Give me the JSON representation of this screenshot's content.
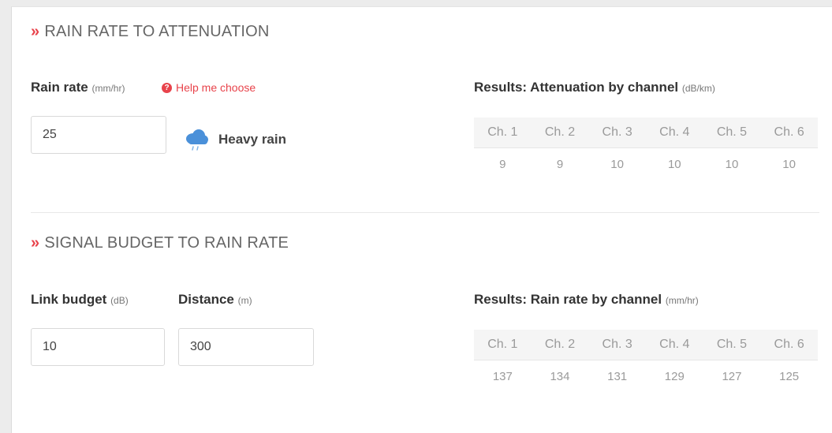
{
  "rain_to_attenuation": {
    "section_title": "RAIN RATE TO ATTENUATION",
    "rain_rate": {
      "label": "Rain rate",
      "unit": "(mm/hr)",
      "value": "25"
    },
    "help_link": "Help me choose",
    "weather_label": "Heavy rain",
    "results": {
      "title": "Results: Attenuation by channel",
      "unit": "(dB/km)",
      "columns": [
        "Ch. 1",
        "Ch. 2",
        "Ch. 3",
        "Ch. 4",
        "Ch. 5",
        "Ch. 6"
      ],
      "values": [
        "9",
        "9",
        "10",
        "10",
        "10",
        "10"
      ]
    }
  },
  "budget_to_rain_rate": {
    "section_title": "SIGNAL BUDGET TO RAIN RATE",
    "link_budget": {
      "label": "Link budget",
      "unit": "(dB)",
      "value": "10"
    },
    "distance": {
      "label": "Distance",
      "unit": "(m)",
      "value": "300"
    },
    "results": {
      "title": "Results: Rain rate by channel",
      "unit": "(mm/hr)",
      "columns": [
        "Ch. 1",
        "Ch. 2",
        "Ch. 3",
        "Ch. 4",
        "Ch. 5",
        "Ch. 6"
      ],
      "values": [
        "137",
        "134",
        "131",
        "129",
        "127",
        "125"
      ]
    }
  },
  "colors": {
    "accent": "#e8434b",
    "cloud": "#4a90d9"
  },
  "icons": {
    "section_marker": "chevron-double-right-icon",
    "help": "question-circle-icon",
    "weather": "rain-cloud-icon"
  }
}
